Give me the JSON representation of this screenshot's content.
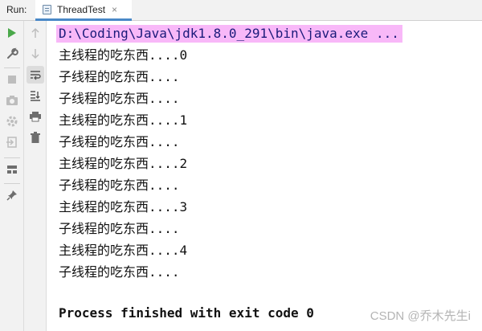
{
  "header": {
    "run_label": "Run:",
    "tab_title": "ThreadTest",
    "tab_close": "×"
  },
  "toolbar_left": [
    {
      "name": "rerun-icon"
    },
    {
      "name": "wrench-icon"
    },
    {
      "name": "stop-icon"
    },
    {
      "name": "camera-icon"
    },
    {
      "name": "gear-icon"
    },
    {
      "name": "login-icon"
    },
    {
      "name": "layout-icon"
    },
    {
      "name": "pin-icon"
    }
  ],
  "toolbar_right": [
    {
      "name": "arrow-up-icon"
    },
    {
      "name": "arrow-down-icon"
    },
    {
      "name": "soft-wrap-icon"
    },
    {
      "name": "scroll-to-end-icon"
    },
    {
      "name": "print-icon"
    },
    {
      "name": "trash-icon"
    }
  ],
  "console": {
    "command": "D:\\Coding\\Java\\jdk1.8.0_291\\bin\\java.exe ...",
    "lines": [
      "主线程的吃东西....0",
      "子线程的吃东西....",
      "子线程的吃东西....",
      "主线程的吃东西....1",
      "子线程的吃东西....",
      "主线程的吃东西....2",
      "子线程的吃东西....",
      "主线程的吃东西....3",
      "子线程的吃东西....",
      "主线程的吃东西....4",
      "子线程的吃东西...."
    ],
    "finished": "Process finished with exit code 0"
  },
  "watermark": "CSDN @乔木先生i",
  "colors": {
    "command_highlight": "#f8b8f8",
    "run_green": "#4aa84a",
    "tab_underline": "#4a88c7"
  }
}
